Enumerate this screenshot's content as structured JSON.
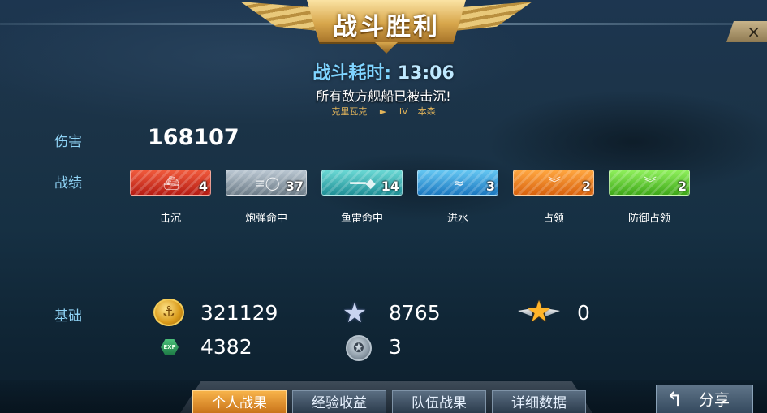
{
  "header": {
    "title": "战斗胜利",
    "close_glyph": "×"
  },
  "summary": {
    "time_label": "战斗耗时:",
    "time_value": "13:06",
    "result_message": "所有敌方舰船已被击沉!",
    "ship_name": "克里瓦克",
    "arrow_glyph": "►",
    "tier": "IV",
    "player_name": "本森"
  },
  "damage": {
    "label": "伤害",
    "value": "168107"
  },
  "record": {
    "label": "战绩",
    "badges": [
      {
        "label": "击沉",
        "count": "4",
        "icon": "ship-icon",
        "color": "#d82a1c"
      },
      {
        "label": "炮弹命中",
        "count": "37",
        "icon": "shell-icon",
        "color": "#8a9aa6"
      },
      {
        "label": "鱼雷命中",
        "count": "14",
        "icon": "torpedo-icon",
        "color": "#2aa3a8"
      },
      {
        "label": "进水",
        "count": "3",
        "icon": "flood-icon",
        "color": "#2a8ed2"
      },
      {
        "label": "占领",
        "count": "2",
        "icon": "capture-icon",
        "color": "#ee7a1c"
      },
      {
        "label": "防御占领",
        "count": "2",
        "icon": "defend-capture-icon",
        "color": "#54c424"
      }
    ]
  },
  "base": {
    "label": "基础",
    "credits": "321129",
    "experience": "4382",
    "silver_star": "8765",
    "medal": "3",
    "gold_star": "0"
  },
  "tabs": [
    {
      "label": "个人战果",
      "active": true
    },
    {
      "label": "经验收益",
      "active": false
    },
    {
      "label": "队伍战果",
      "active": false
    },
    {
      "label": "详细数据",
      "active": false
    }
  ],
  "share": {
    "label": "分享",
    "arrow_glyph": "↰"
  },
  "icon_glyphs": {
    "coin": "⚓",
    "exp": "EXP",
    "silver_star": "★",
    "medal": "✪",
    "gold_star": "★"
  }
}
